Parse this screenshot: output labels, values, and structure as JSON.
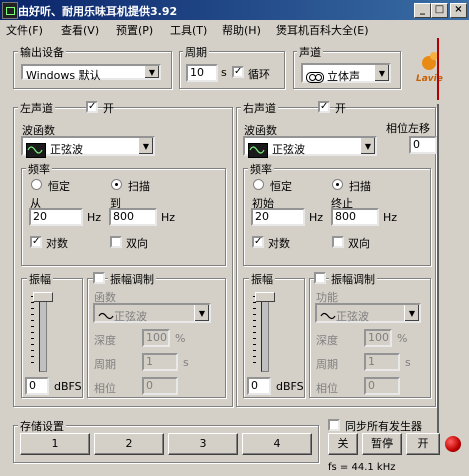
{
  "window": {
    "title": "由好听、耐用乐味耳机提供3.92",
    "btn_min": "_",
    "btn_max": "□",
    "btn_close": "×"
  },
  "menu": [
    "文件(F)",
    "查看(V)",
    "预置(P)",
    "工具(T)",
    "帮助(H)",
    "煲耳机百科大全(E)"
  ],
  "output": {
    "label": "输出设备",
    "device": "Windows 默认"
  },
  "period": {
    "label": "周期",
    "value": "10",
    "unit": "s",
    "loop_label": "循环",
    "loop_checked": true
  },
  "channel": {
    "label": "声道",
    "value": "立体声"
  },
  "brand": {
    "logo_text": "Lavie"
  },
  "left": {
    "label": "左声道",
    "on_label": "开",
    "on": true,
    "waveform_label": "波函数",
    "waveform": "正弦波",
    "freq_label": "频率",
    "const_label": "恒定",
    "sweep_label": "扫描",
    "mode": "sweep",
    "from_label": "从",
    "to_label": "到",
    "from": "20",
    "to": "800",
    "hz": "Hz",
    "log_label": "对数",
    "log": true,
    "bidir_label": "双向",
    "bidir": false,
    "amp_label": "振幅",
    "amp_value": "0",
    "amp_unit": "dBFS",
    "am_label": "振幅调制",
    "am": false,
    "func_label": "函数",
    "func_value": "正弦波",
    "depth_label": "深度",
    "depth_value": "100",
    "depth_unit": "%",
    "period_label": "周期",
    "period_value": "1",
    "period_unit": "s",
    "phase_label": "相位",
    "phase_value": "0"
  },
  "right": {
    "label": "右声道",
    "on_label": "开",
    "on": true,
    "waveform_label": "波函数",
    "waveform": "正弦波",
    "phase_shift_label": "相位左移",
    "phase_shift": "0",
    "freq_label": "频率",
    "const_label": "恒定",
    "sweep_label": "扫描",
    "mode": "sweep",
    "from_label": "初始",
    "to_label": "终止",
    "from": "20",
    "to": "800",
    "hz": "Hz",
    "log_label": "对数",
    "log": true,
    "bidir_label": "双向",
    "bidir": false,
    "amp_label": "振幅",
    "amp_value": "0",
    "amp_unit": "dBFS",
    "am_label": "振幅调制",
    "am": false,
    "func_label": "功能",
    "func_value": "正弦波",
    "depth_label": "深度",
    "depth_value": "100",
    "depth_unit": "%",
    "period_label": "周期",
    "period_value": "1",
    "period_unit": "s",
    "phase_label": "相位",
    "phase_value": "0"
  },
  "storage": {
    "label": "存储设置",
    "slots": [
      "1",
      "2",
      "3",
      "4"
    ]
  },
  "sync": {
    "label": "同步所有发生器",
    "checked": false
  },
  "controls": {
    "off": "关",
    "pause": "暂停",
    "on": "开"
  },
  "status": {
    "fs": "fs = 44.1 kHz"
  },
  "colors": {
    "title_start": "#0a246a",
    "title_end": "#3a6ea5",
    "face": "#d4d0c8",
    "record_red": "#c00000"
  }
}
